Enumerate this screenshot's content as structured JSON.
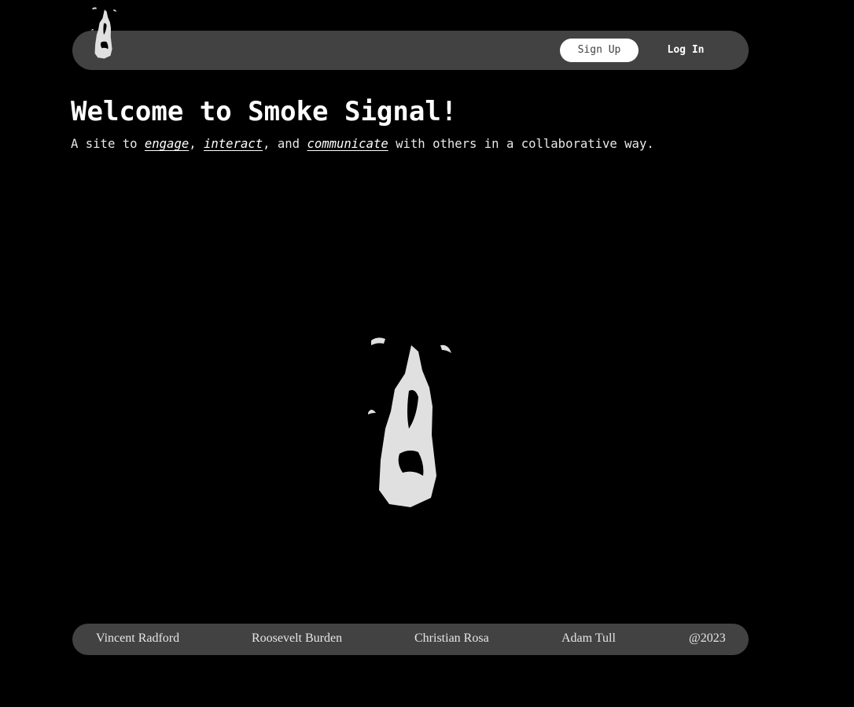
{
  "nav": {
    "logo_icon": "smoke-flame-icon",
    "signup_label": "Sign Up",
    "login_label": "Log In"
  },
  "hero": {
    "title": "Welcome to Smoke Signal!",
    "sub_prefix": "A site to ",
    "kw1": "engage",
    "sep1": ", ",
    "kw2": "interact",
    "sep2": ", and ",
    "kw3": "communicate",
    "sub_suffix": " with others in a collaborative way.",
    "logo_icon": "smoke-flame-icon"
  },
  "footer": {
    "items": [
      "Vincent Radford",
      "Roosevelt Burden",
      "Christian Rosa",
      "Adam Tull",
      "@2023"
    ]
  },
  "colors": {
    "background": "#000000",
    "bar": "#424242",
    "smoke": "#e0e0e0",
    "text": "#ffffff"
  }
}
